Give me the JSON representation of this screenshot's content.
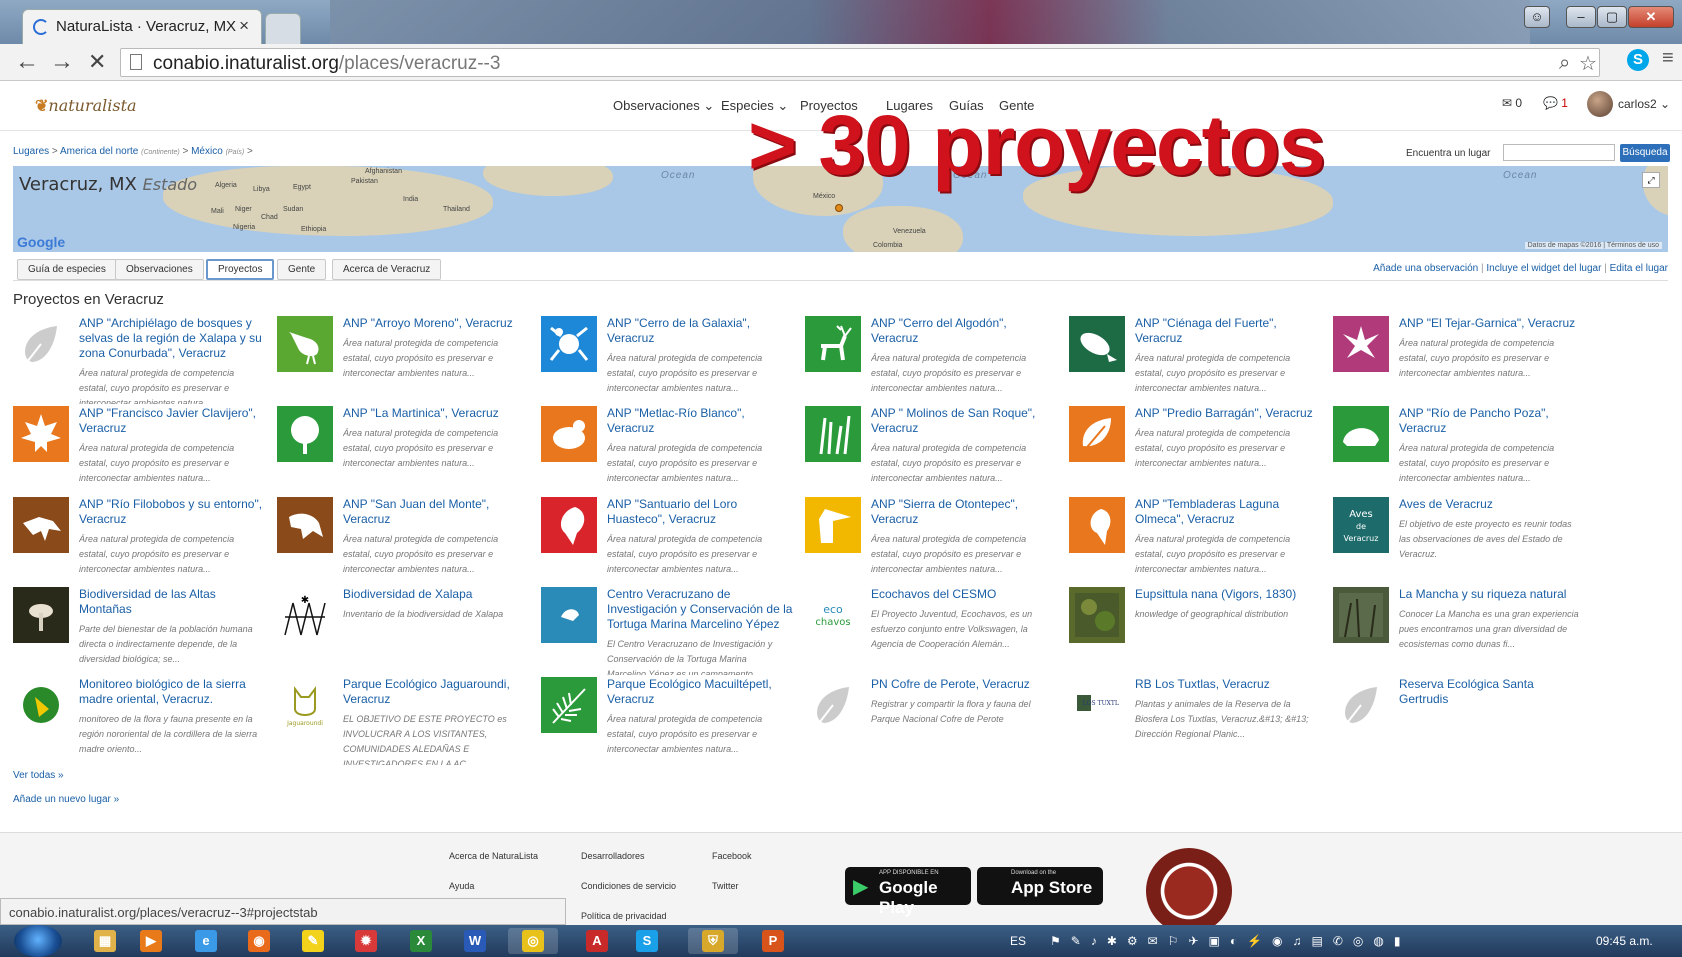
{
  "browser": {
    "tab_title": "NaturaLista · Veracruz, MX",
    "tab_close": "×",
    "url_host": "conabio.inaturalist.org",
    "url_path": "/places/veracruz--3",
    "status_url": "conabio.inaturalist.org/places/veracruz--3#projectstab"
  },
  "header": {
    "logo": "naturalista",
    "nav": [
      "Observaciones ⌄",
      "Especies ⌄",
      "Proyectos",
      "Lugares",
      "Guías",
      "Gente"
    ],
    "messages_count": "0",
    "notifications_count": "1",
    "username": "carlos2 ⌄"
  },
  "overlay_text": "> 30 proyectos",
  "breadcrumb": {
    "items": [
      "Lugares",
      "America del norte",
      "México"
    ],
    "qualifiers": [
      "(Continente)",
      "(País)"
    ]
  },
  "find_place": {
    "label": "Encuentra un lugar",
    "button": "Búsqueda"
  },
  "map": {
    "title": "Veracruz, MX",
    "type": "Estado",
    "ocean_labels": [
      "Ocean",
      "Ocean",
      "Ocean"
    ],
    "places": [
      "Afghanistan",
      "Pakistan",
      "India",
      "Algeria",
      "Libya",
      "Egypt",
      "Mali",
      "Niger",
      "Chad",
      "Sudan",
      "Nigeria",
      "Ethiopia",
      "Thailand",
      "México",
      "Venezuela",
      "Colombia"
    ],
    "google": "Google",
    "credit": "Datos de mapas ©2016 | Términos de uso"
  },
  "tabs": [
    "Guía de especies",
    "Observaciones",
    "Proyectos",
    "Gente",
    "Acerca de Veracruz"
  ],
  "right_links": [
    "Añade una observación",
    "Incluye el widget del lugar",
    "Edita el lugar"
  ],
  "section_title": "Proyectos en Veracruz",
  "projects": [
    {
      "title": "ANP \"Archipiélago de bosques y selvas de la región de Xalapa y su zona Conurbada\", Veracruz",
      "desc": "Área natural protegida de competencia estatal, cuyo propósito es preservar e interconectar ambientes natura...",
      "icon": "leaf-placeholder",
      "color": "#fff"
    },
    {
      "title": "ANP \"Arroyo Moreno\", Veracruz",
      "desc": "Área natural protegida de competencia estatal, cuyo propósito es preservar e interconectar ambientes natura...",
      "icon": "heron",
      "color": "#5aa832"
    },
    {
      "title": "ANP \"Cerro de la Galaxia\", Veracruz",
      "desc": "Área natural protegida de competencia estatal, cuyo propósito es preservar e interconectar ambientes natura...",
      "icon": "frog",
      "color": "#1e88d8"
    },
    {
      "title": "ANP \"Cerro del Algodón\", Veracruz",
      "desc": "Área natural protegida de competencia estatal, cuyo propósito es preservar e interconectar ambientes natura...",
      "icon": "deer",
      "color": "#2a9a3a"
    },
    {
      "title": "ANP \"Ciénaga del Fuerte\", Veracruz",
      "desc": "Área natural protegida de competencia estatal, cuyo propósito es preservar e interconectar ambientes natura...",
      "icon": "manatee",
      "color": "#1d6b45"
    },
    {
      "title": "ANP \"El Tejar-Garnica\", Veracruz",
      "desc": "Área natural protegida de competencia estatal, cuyo propósito es preservar e interconectar ambientes natura...",
      "icon": "flower",
      "color": "#b03a7a"
    },
    {
      "title": "ANP \"Francisco Javier Clavijero\", Veracruz",
      "desc": "Área natural protegida de competencia estatal, cuyo propósito es preservar e interconectar ambientes natura...",
      "icon": "maple-leaf",
      "color": "#e8771d"
    },
    {
      "title": "ANP \"La Martinica\", Veracruz",
      "desc": "Área natural protegida de competencia estatal, cuyo propósito es preservar e interconectar ambientes natura...",
      "icon": "tree",
      "color": "#2a9a3a"
    },
    {
      "title": "ANP \"Metlac-Río Blanco\", Veracruz",
      "desc": "Área natural protegida de competencia estatal, cuyo propósito es preservar e interconectar ambientes natura...",
      "icon": "quail",
      "color": "#e8771d"
    },
    {
      "title": "ANP \" Molinos de San Roque\", Veracruz",
      "desc": "Área natural protegida de competencia estatal, cuyo propósito es preservar e interconectar ambientes natura...",
      "icon": "grass",
      "color": "#2a9a3a"
    },
    {
      "title": "ANP \"Predio Barragán\", Veracruz",
      "desc": "Área natural protegida de competencia estatal, cuyo propósito es preservar e interconectar ambientes natura...",
      "icon": "leaf",
      "color": "#e8771d"
    },
    {
      "title": "ANP \"Río de Pancho Poza\", Veracruz",
      "desc": "Área natural protegida de competencia estatal, cuyo propósito es preservar e interconectar ambientes natura...",
      "icon": "armadillo",
      "color": "#2a9a3a"
    },
    {
      "title": "ANP \"Río Filobobos y su entorno\", Veracruz",
      "desc": "Área natural protegida de competencia estatal, cuyo propósito es preservar e interconectar ambientes natura...",
      "icon": "iguana",
      "color": "#8a4a1a"
    },
    {
      "title": "ANP \"San Juan del Monte\", Veracruz",
      "desc": "Área natural protegida de competencia estatal, cuyo propósito es preservar e interconectar ambientes natura...",
      "icon": "lizard",
      "color": "#8a4a1a"
    },
    {
      "title": "ANP \"Santuario del Loro Huasteco\", Veracruz",
      "desc": "Área natural protegida de competencia estatal, cuyo propósito es preservar e interconectar ambientes natura...",
      "icon": "parrot",
      "color": "#d8242a"
    },
    {
      "title": "ANP \"Sierra de Otontepec\", Veracruz",
      "desc": "Área natural protegida de competencia estatal, cuyo propósito es preservar e interconectar ambientes natura...",
      "icon": "toucan",
      "color": "#f2b800"
    },
    {
      "title": "ANP \"Tembladeras Laguna Olmeca\", Veracruz",
      "desc": "Área natural protegida de competencia estatal, cuyo propósito es preservar e interconectar ambientes natura...",
      "icon": "bird",
      "color": "#e8771d"
    },
    {
      "title": "Aves de Veracruz",
      "desc": "El objetivo de este proyecto es reunir todas las observaciones de aves del Estado de Veracruz.",
      "icon": "aves-text",
      "color": "#1d6b6b",
      "thumb_text": "Aves de Veracruz"
    },
    {
      "title": "Biodiversidad de las Altas Montañas",
      "desc": "Parte del bienestar de la población humana directa o indirectamente depende, de la diversidad biológica; se...",
      "icon": "mushroom-photo",
      "color": "#2a2a1a"
    },
    {
      "title": "Biodiversidad de Xalapa",
      "desc": "Inventario de la biodiversidad de Xalapa",
      "icon": "pattern",
      "color": "#fff"
    },
    {
      "title": "Centro Veracruzano de Investigación y Conservación de la Tortuga Marina Marcelino Yépez",
      "desc": "El Centro Veracruzano de Investigación y Conservación de la Tortuga Marina Marcelino Yépez es un campamento...",
      "icon": "turtle-logo",
      "color": "#2a8ab8"
    },
    {
      "title": "Ecochavos del CESMO",
      "desc": "El Proyecto Juventud, Ecochavos, es un esfuerzo conjunto entre Volkswagen, la Agencia de Cooperación Alemán...",
      "icon": "ecochavos-logo",
      "color": "#fff",
      "thumb_text": "eco chavos"
    },
    {
      "title": "Eupsittula nana (Vigors, 1830)",
      "desc": "knowledge of geographical distribution",
      "icon": "parrot-photo",
      "color": "#5a6a2a"
    },
    {
      "title": "La Mancha y su riqueza natural",
      "desc": "Conocer La Mancha es una gran experiencia pues encontramos una gran diversidad de ecosistemas como dunas fi...",
      "icon": "mangrove-photo",
      "color": "#4a5a3a"
    },
    {
      "title": "Monitoreo biológico de la sierra madre oriental, Veracruz.",
      "desc": "monitoreo de la flora y fauna presente en la región nororiental de la cordillera de la sierra madre oriento...",
      "icon": "monitoreo-logo",
      "color": "#fff"
    },
    {
      "title": "Parque Ecológico Jaguaroundi, Veracruz",
      "desc": "EL OBJETIVO DE ESTE PROYECTO es INVOLUCRAR A LOS VISITANTES, COMUNIDADES ALEDAÑAS E INVESTIGADORES EN LA AC...",
      "icon": "jaguaroundi-logo",
      "color": "#fff",
      "thumb_text": "Jaguaroundi"
    },
    {
      "title": "Parque Ecológico Macuiltépetl, Veracruz",
      "desc": "Área natural protegida de competencia estatal, cuyo propósito es preservar e interconectar ambientes natura...",
      "icon": "fern",
      "color": "#2a9a3a"
    },
    {
      "title": "PN Cofre de Perote, Veracruz",
      "desc": "Registrar y compartir la flora y fauna del Parque Nacional Cofre de Perote",
      "icon": "leaf-placeholder",
      "color": "#fff"
    },
    {
      "title": "RB Los Tuxtlas, Veracruz",
      "desc": "Plantas y animales de la Reserva de la Biosfera Los Tuxtlas, Veracruz.&#13; &#13; Dirección Regional Planic...",
      "icon": "tuxtlas-logo",
      "color": "#fff",
      "thumb_text": "LOS TUXTLAS"
    },
    {
      "title": "Reserva Ecológica Santa Gertrudis",
      "desc": "",
      "icon": "leaf-placeholder",
      "color": "#fff"
    }
  ],
  "more_links": [
    "Ver todas »",
    "Añade un nuevo lugar »"
  ],
  "footer": {
    "col1": [
      "Acerca de NaturaLista",
      "Ayuda"
    ],
    "col2": [
      "Desarrolladores",
      "Condiciones de servicio",
      "Política de privacidad"
    ],
    "col3": [
      "Facebook",
      "Twitter"
    ],
    "google_play_small": "APP DISPONIBLE EN",
    "google_play": "Google Play",
    "app_store_small": "Download on the",
    "app_store": "App Store"
  },
  "taskbar": {
    "apps": [
      "explorer",
      "media",
      "ie",
      "firefox",
      "pdf",
      "paint",
      "excel",
      "word",
      "chrome",
      "acrobat",
      "skype",
      "shield",
      "powerpoint"
    ],
    "lang": "ES",
    "time": "09:45 a.m."
  },
  "colors": {
    "link": "#1a5fa6",
    "accent_red": "#d0121c",
    "search_btn": "#2d6fb9"
  }
}
